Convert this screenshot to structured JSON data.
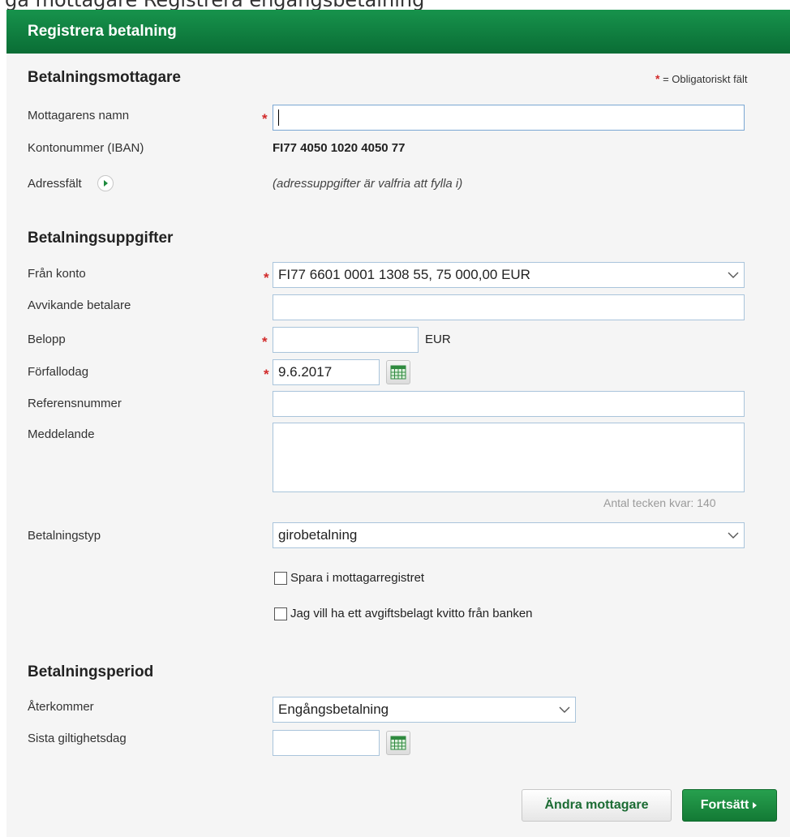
{
  "top_partial_text": "ga  mottagare  Registrera engångsbetalning",
  "header": {
    "title": "Registrera betalning"
  },
  "legend": {
    "star": "*",
    "text": "= Obligatoriskt fält"
  },
  "recipient": {
    "title": "Betalningsmottagare",
    "name_label": "Mottagarens namn",
    "name_value": "",
    "iban_label": "Kontonummer (IBAN)",
    "iban_value": "FI77 4050 1020 4050 77",
    "address_label": "Adressfält",
    "address_hint": "(adressuppgifter är valfria att fylla i)"
  },
  "payment": {
    "title": "Betalningsuppgifter",
    "from_label": "Från konto",
    "from_value": "FI77 6601 0001 1308 55, 75 000,00 EUR",
    "payer_label": "Avvikande betalare",
    "payer_value": "",
    "amount_label": "Belopp",
    "amount_value": "",
    "currency": "EUR",
    "due_label": "Förfallodag",
    "due_value": "9.6.2017",
    "ref_label": "Referensnummer",
    "ref_value": "",
    "message_label": "Meddelande",
    "message_value": "",
    "chars_left": "Antal tecken kvar: 140",
    "type_label": "Betalningstyp",
    "type_value": "girobetalning",
    "save_checkbox_label": "Spara i mottagarregistret",
    "receipt_checkbox_label": "Jag vill ha ett avgiftsbelagt kvitto från banken"
  },
  "period": {
    "title": "Betalningsperiod",
    "recurring_label": "Återkommer",
    "recurring_value": "Engångsbetalning",
    "last_valid_label": "Sista giltighetsdag",
    "last_valid_value": ""
  },
  "buttons": {
    "change_recipient": "Ändra mottagare",
    "continue": "Fortsätt"
  },
  "colors": {
    "header_green": "#0f7f3f",
    "required_red": "#d22a2a",
    "input_border": "#a9c4db",
    "panel_bg": "#f5f5f5"
  },
  "icons": [
    "chevron-down-icon",
    "calendar-icon",
    "arrow-right-icon"
  ]
}
